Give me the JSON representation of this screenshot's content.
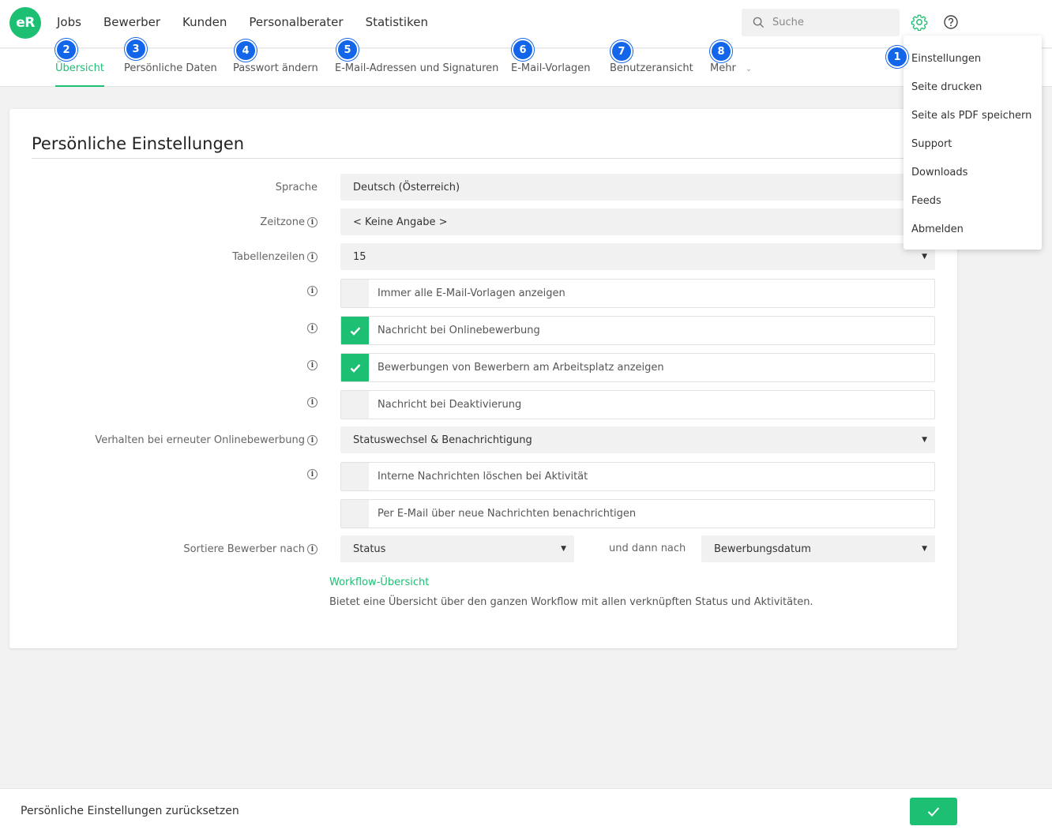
{
  "app": {
    "logo_text": "eR",
    "brand_color": "#1dbf73",
    "badge_color": "#1366e9"
  },
  "mainnav": [
    "Jobs",
    "Bewerber",
    "Kunden",
    "Personalberater",
    "Statistiken"
  ],
  "search": {
    "placeholder": "Suche",
    "icon": "search-icon"
  },
  "header_icons": [
    "gear-icon",
    "help-icon"
  ],
  "subnav": {
    "tabs": [
      {
        "label": "Übersicht",
        "badge": "2"
      },
      {
        "label": "Persönliche Daten",
        "badge": "3"
      },
      {
        "label": "Passwort ändern",
        "badge": "4"
      },
      {
        "label": "E-Mail-Adressen und Signaturen",
        "badge": "5"
      },
      {
        "label": "E-Mail-Vorlagen",
        "badge": "6"
      },
      {
        "label": "Benutzeransicht",
        "badge": "7"
      },
      {
        "label": "Mehr",
        "badge": "8"
      }
    ],
    "active": "Übersicht"
  },
  "menu": {
    "badge": "1",
    "items": [
      "Einstellungen",
      "Seite drucken",
      "Seite als PDF speichern",
      "Support",
      "Downloads",
      "Feeds",
      "Abmelden"
    ]
  },
  "settings": {
    "title": "Persönliche Einstellungen",
    "language": {
      "label": "Sprache",
      "value": "Deutsch (Österreich)"
    },
    "timezone": {
      "label": "Zeitzone",
      "value": "< Keine Angabe >"
    },
    "table_rows": {
      "label": "Tabellenzeilen",
      "value": "15"
    },
    "checkboxes": [
      {
        "label": "Immer alle E-Mail-Vorlagen anzeigen",
        "checked": false
      },
      {
        "label": "Nachricht bei Onlinebewerbung",
        "checked": true
      },
      {
        "label": "Bewerbungen von Bewerbern am Arbeitsplatz anzeigen",
        "checked": true
      },
      {
        "label": "Nachricht bei Deaktivierung",
        "checked": false
      }
    ],
    "reapply": {
      "label": "Verhalten bei erneuter Onlinebewerbung",
      "value": "Statuswechsel & Benachrichtigung"
    },
    "checkboxes2": [
      {
        "label": "Interne Nachrichten löschen bei Aktivität",
        "checked": false
      },
      {
        "label": "Per E-Mail über neue Nachrichten benachrichtigen",
        "checked": false
      }
    ],
    "sort": {
      "label": "Sortiere Bewerber nach",
      "first": "Status",
      "then_label": "und dann nach",
      "second": "Bewerbungsdatum"
    },
    "workflow_link": "Workflow-Übersicht",
    "workflow_desc": "Bietet eine Übersicht über den ganzen Workflow mit allen verknüpften Status und Aktivitäten."
  },
  "footer": {
    "reset_label": "Persönliche Einstellungen zurücksetzen",
    "confirm_icon": "checkmark-icon"
  }
}
